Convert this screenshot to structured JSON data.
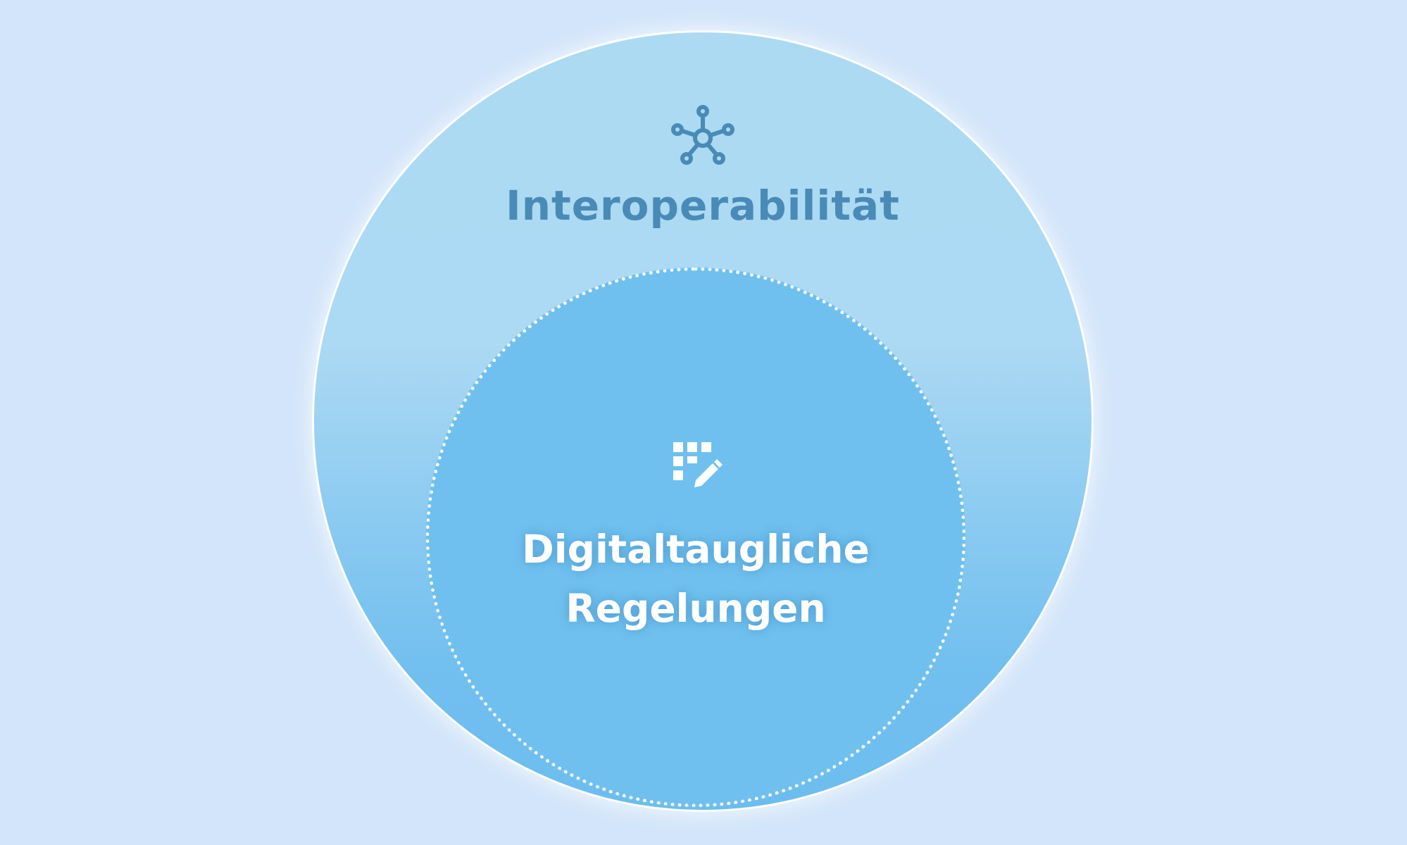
{
  "diagram": {
    "outer": {
      "label": "Interoperabilität",
      "icon": "network-nodes-icon",
      "color": "#4a8ab6"
    },
    "inner": {
      "label_line1": "Digitaltaugliche",
      "label_line2": "Regelungen",
      "icon": "grid-pencil-icon",
      "color": "#ffffff"
    },
    "colors": {
      "background": "#d2e5fa",
      "outer_top": "#acdaf3",
      "outer_bottom": "#6cbdef",
      "inner_fill": "#6fc0ee",
      "border": "#ffffff"
    }
  }
}
